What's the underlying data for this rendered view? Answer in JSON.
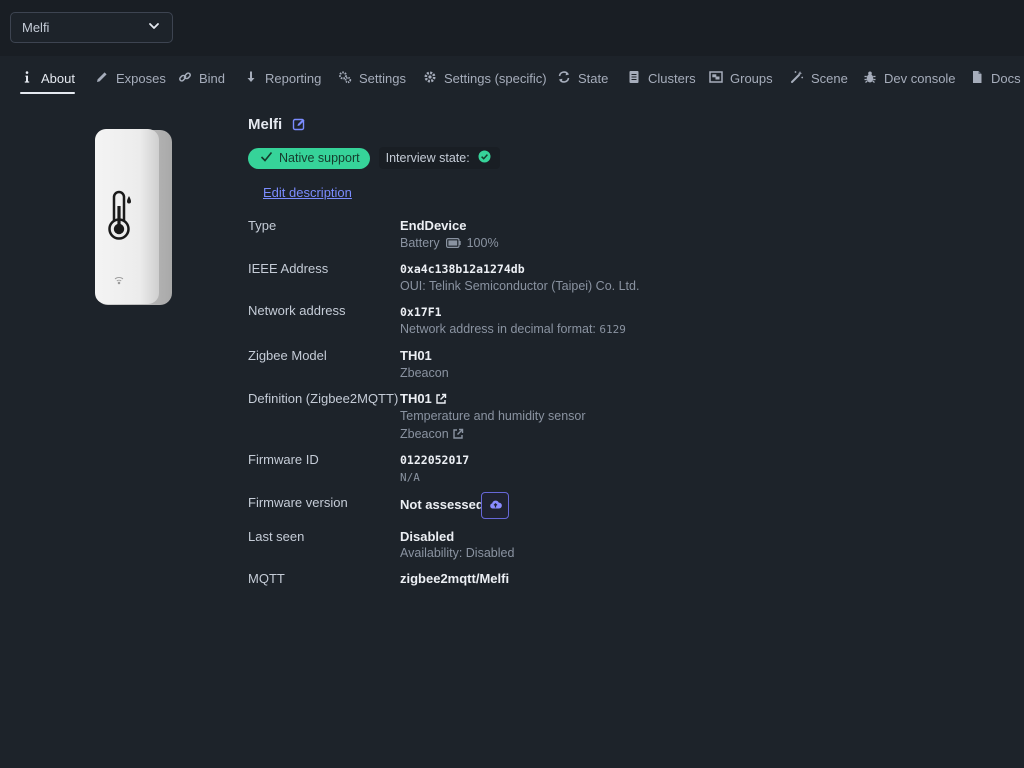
{
  "header": {
    "device_select_value": "Melfi",
    "chevron_icon": "chevron-down-icon"
  },
  "tabs": [
    {
      "label": "About",
      "icon": "info-icon",
      "active": true
    },
    {
      "label": "Exposes",
      "icon": "pencil-icon"
    },
    {
      "label": "Bind",
      "icon": "link-icon"
    },
    {
      "label": "Reporting",
      "icon": "arrow-down-icon"
    },
    {
      "label": "Settings",
      "icon": "cogs-icon"
    },
    {
      "label": "Settings (specific)",
      "icon": "gear-icon"
    },
    {
      "label": "State",
      "icon": "sync-icon"
    },
    {
      "label": "Clusters",
      "icon": "document-icon"
    },
    {
      "label": "Groups",
      "icon": "object-group-icon"
    },
    {
      "label": "Scene",
      "icon": "magic-wand-icon"
    },
    {
      "label": "Dev console",
      "icon": "bug-icon"
    },
    {
      "label": "Docs",
      "icon": "file-icon"
    }
  ],
  "device": {
    "name": "Melfi",
    "native_support": "Native support",
    "interview_state": "Interview state:",
    "edit_description": "Edit description",
    "colors": {
      "accent_green": "#36d399",
      "link": "#7b8cff",
      "button_border": "#6767d8"
    }
  },
  "details": {
    "type": {
      "label": "Type",
      "value": "EndDevice",
      "sub_prefix": "Battery",
      "sub_value": "100%"
    },
    "ieee": {
      "label": "IEEE Address",
      "value": "0xa4c138b12a1274db",
      "sub": "OUI: Telink Semiconductor (Taipei) Co. Ltd."
    },
    "network": {
      "label": "Network address",
      "value": "0x17F1",
      "sub_prefix": "Network address in decimal format:",
      "sub_value": "6129"
    },
    "model": {
      "label": "Zigbee Model",
      "value": "TH01",
      "sub": "Zbeacon"
    },
    "definition": {
      "label": "Definition (Zigbee2MQTT)",
      "value": "TH01",
      "sub": "Temperature and humidity sensor",
      "vendor": "Zbeacon"
    },
    "firmware_id": {
      "label": "Firmware ID",
      "value": "0122052017",
      "sub": "N/A"
    },
    "firmware_version": {
      "label": "Firmware version",
      "value": "Not assessed",
      "button_icon": "cloud-upload-icon"
    },
    "last_seen": {
      "label": "Last seen",
      "value": "Disabled",
      "sub": "Availability: Disabled"
    },
    "mqtt": {
      "label": "MQTT",
      "value": "zigbee2mqtt/Melfi"
    }
  }
}
